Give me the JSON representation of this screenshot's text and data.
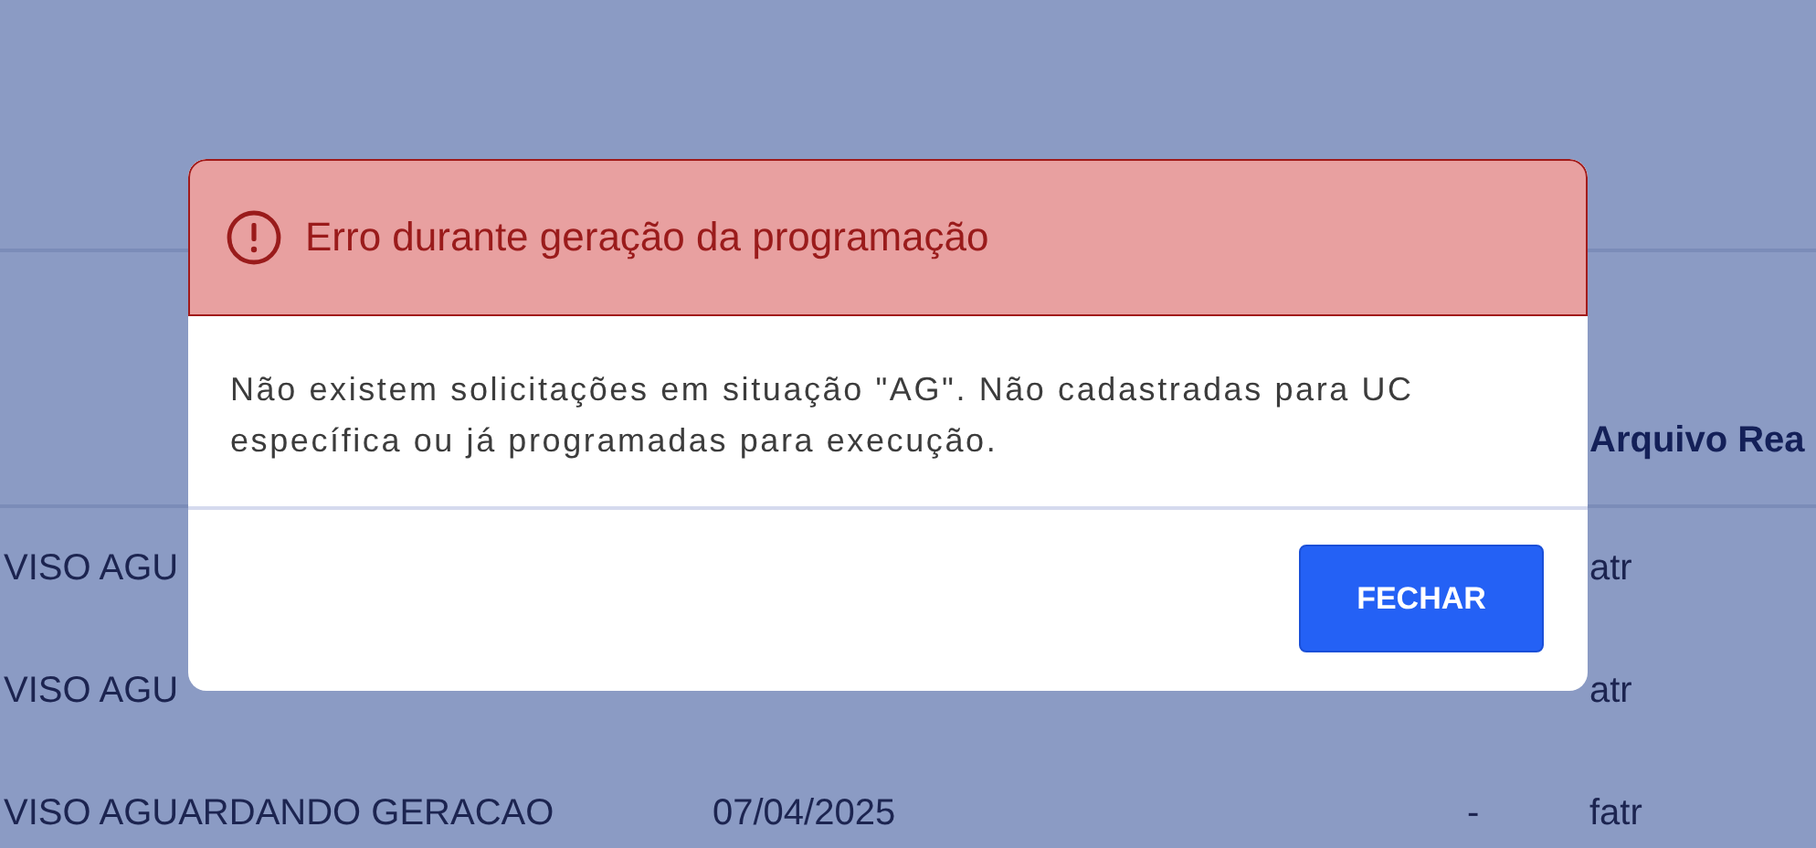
{
  "table": {
    "header": {
      "column_4": "Arquivo Rea"
    },
    "rows": [
      {
        "column_1": "VISO AGU",
        "column_4": "atr"
      },
      {
        "column_1": "VISO AGU",
        "column_4": "atr"
      },
      {
        "column_1": "VISO AGUARDANDO GERACAO",
        "column_2": "07/04/2025",
        "column_3": "-",
        "column_4": "fatr"
      }
    ]
  },
  "dialog": {
    "title": "Erro durante geração da programação",
    "message": "Não existem solicitações em situação \"AG\". Não cadastradas para UC específica ou já programadas para execução.",
    "buttons": [
      "FECHAR"
    ]
  }
}
